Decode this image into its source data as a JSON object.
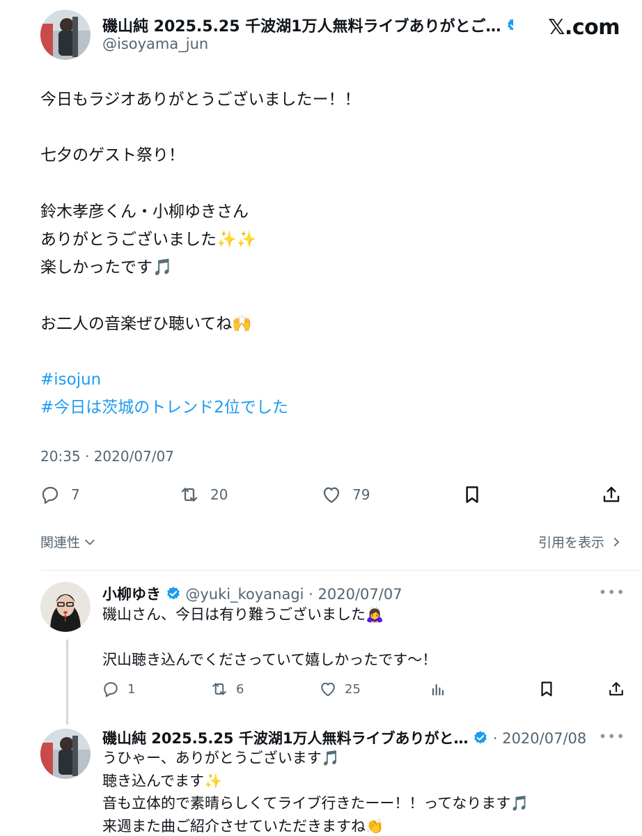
{
  "site_logo": "𝕏.com",
  "tweet": {
    "author_name": "磯山純 2025.5.25 千波湖1万人無料ライブありがとご…",
    "author_handle": "@isoyama_jun",
    "lines": [
      "今日もラジオありがとうございましたー！！",
      "",
      "七夕のゲスト祭り！",
      "",
      "鈴木孝彦くん・小柳ゆきさん",
      "ありがとうございました✨✨",
      "楽しかったです🎵",
      "",
      "お二人の音楽ぜひ聴いてね🙌",
      ""
    ],
    "hashtags": [
      "#isojun",
      "#今日は茨城のトレンド2位でした"
    ],
    "timestamp": "20:35 · 2020/07/07",
    "actions": {
      "reply_count": "7",
      "retweet_count": "20",
      "like_count": "79"
    }
  },
  "related_label": "関連性",
  "view_quotes_label": "引用を表示",
  "replies": [
    {
      "author_name": "小柳ゆき",
      "meta": "@yuki_koyanagi · 2020/07/07",
      "lines": [
        "磯山さん、今日は有り難うございました🙇‍♀️",
        "",
        "沢山聴き込んでくださっていて嬉しかったです〜！"
      ],
      "reply_count": "1",
      "retweet_count": "6",
      "like_count": "25"
    },
    {
      "author_name": "磯山純 2025.5.25 千波湖1万人無料ライブありがと…",
      "meta": "· 2020/07/08",
      "lines": [
        "うひゃー、ありがとうございます🎵",
        "聴き込んでます✨",
        "音も立体的で素晴らしくてライブ行きたーー！！ってなります🎵",
        "来週また曲ご紹介させていただきますね👏"
      ]
    }
  ],
  "icons": {
    "verified": "verified-badge-icon",
    "reply": "reply-icon",
    "retweet": "retweet-icon",
    "like": "heart-icon",
    "bookmark": "bookmark-icon",
    "share": "share-icon",
    "analytics": "analytics-icon",
    "more": "more-icon"
  },
  "colors": {
    "accent": "#1d9bf0",
    "text": "#0f1419",
    "secondary": "#536471",
    "verified": "#1d9bf0"
  }
}
